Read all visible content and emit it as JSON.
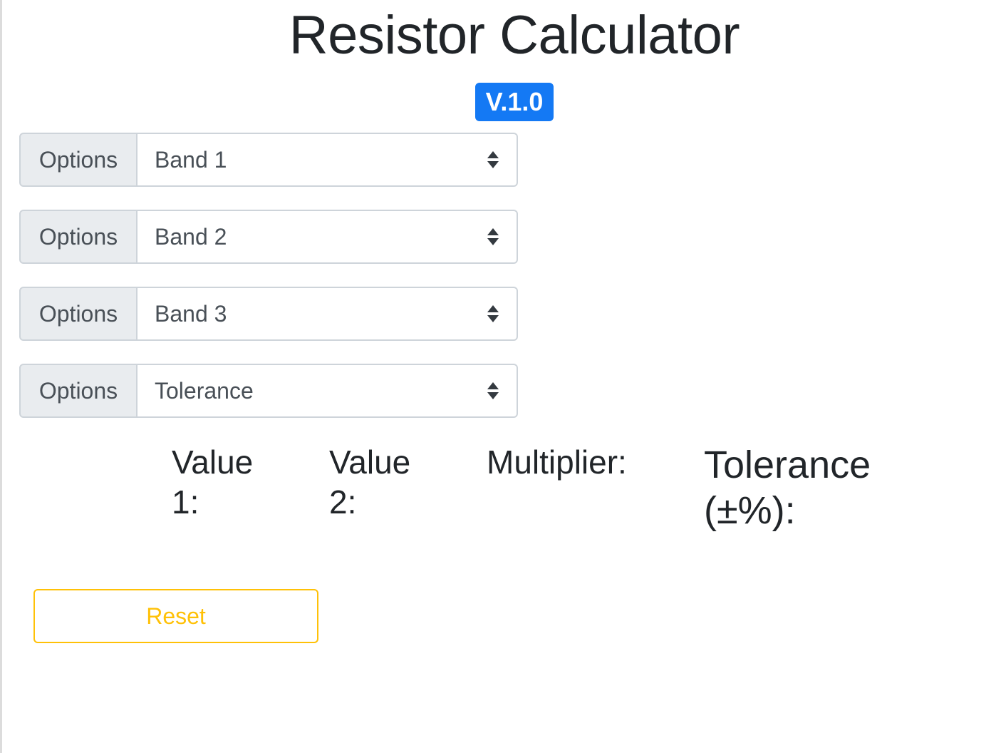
{
  "header": {
    "title": "Resistor Calculator",
    "version_badge": "V.1.0"
  },
  "bands": [
    {
      "prefix_label": "Options",
      "selected": "Band 1"
    },
    {
      "prefix_label": "Options",
      "selected": "Band 2"
    },
    {
      "prefix_label": "Options",
      "selected": "Band 3"
    },
    {
      "prefix_label": "Options",
      "selected": "Tolerance"
    }
  ],
  "results": {
    "value1_label": "Value 1:",
    "value2_label": "Value 2:",
    "multiplier_label": "Multiplier:",
    "tolerance_label": "Tolerance (±%):"
  },
  "actions": {
    "reset_label": "Reset"
  },
  "colors": {
    "badge": "#1479f4",
    "reset_outline": "#ffc107",
    "prepend_bg": "#e9ecef",
    "border": "#ced4da"
  },
  "icons": {
    "select_caret": "sort-arrows-icon"
  }
}
